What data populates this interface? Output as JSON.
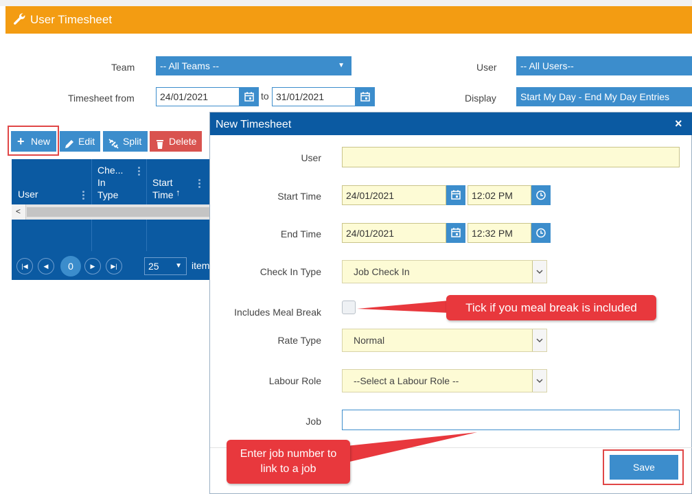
{
  "header": {
    "title": "User Timesheet",
    "icon": "wrench-icon"
  },
  "filters": {
    "team_label": "Team",
    "team_value": "-- All Teams --",
    "user_label": "User",
    "user_value": "-- All Users--",
    "from_label": "Timesheet from",
    "from_date": "24/01/2021",
    "to_label": "to",
    "to_date": "31/01/2021",
    "display_label": "Display",
    "display_value": "Start My Day - End My Day Entries"
  },
  "toolbar": {
    "new_label": "New",
    "edit_label": "Edit",
    "split_label": "Split",
    "delete_label": "Delete"
  },
  "grid": {
    "columns": [
      "User",
      "Che...\nIn\nType",
      "Start\nTime"
    ],
    "col_user": "User",
    "col_checkin_1": "Che...",
    "col_checkin_2": "In",
    "col_checkin_3": "Type",
    "col_start_1": "Start",
    "col_start_2": "Time",
    "sort_indicator": "↑",
    "pager": {
      "current_page": "0",
      "page_size": "25",
      "items_label": "item"
    }
  },
  "modal": {
    "title": "New Timesheet",
    "close": "×",
    "user_label": "User",
    "user_value": "",
    "start_label": "Start Time",
    "start_date": "24/01/2021",
    "start_time": "12:02 PM",
    "end_label": "End Time",
    "end_date": "24/01/2021",
    "end_time": "12:32 PM",
    "checkin_label": "Check In Type",
    "checkin_value": "Job Check In",
    "meal_label": "Includes Meal Break",
    "meal_checked": false,
    "rate_label": "Rate Type",
    "rate_value": "Normal",
    "labour_label": "Labour Role",
    "labour_value": "--Select a Labour Role --",
    "job_label": "Job",
    "job_value": "",
    "save_label": "Save"
  },
  "callouts": {
    "meal": "Tick if you meal break is included",
    "job_line1": "Enter job number to",
    "job_line2": "link to a job"
  },
  "colors": {
    "header_orange": "#f39c12",
    "primary_blue": "#3c8dcc",
    "grid_blue": "#0b5aa2",
    "delete_red": "#d9534f",
    "callout_red": "#e8383d",
    "highlight_red": "#e04646",
    "field_yellow": "#fdfbd5"
  }
}
